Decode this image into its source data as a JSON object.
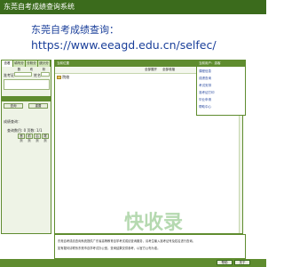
{
  "window": {
    "title": "东莞自考成绩查询系统"
  },
  "overlay": {
    "line1": "东莞自考成绩查询：",
    "line2": "https://www.eeagd.edu.cn/selfec/"
  },
  "left_panel": {
    "tabs": [
      "查看",
      "填写分数",
      "分析分布",
      "统计分析"
    ],
    "fields": [
      {
        "label": "准考证",
        "value": ""
      },
      {
        "label": "姓名",
        "value": ""
      }
    ],
    "buttons": [
      "查询",
      "重置"
    ],
    "result_label": "成绩查询：",
    "count_label": "查询数目: 0  页数: 1/1",
    "pager": [
      "首页",
      "前页",
      "后页",
      "尾页"
    ]
  },
  "main_panel": {
    "header": "当前位置",
    "toolbar": [
      "全部展开",
      "全部收缩"
    ],
    "tree_root": "院校"
  },
  "right_panel": {
    "header": "当前用户：游客",
    "items": [
      "课程信息",
      "成绩查询",
      "考试安排",
      "准考证打印",
      "毕业申请",
      "帮助中心"
    ]
  },
  "bottom_text": [
    "东莞自考成绩查询系统提供广东省高等教育自学考试成绩查询服务，请考生输入准考证号及姓名进行查询。",
    "如有疑问请联系东莞市自学考试办公室。查询结果仅供参考，以官方公布为准。"
  ],
  "status_buttons": [
    "帮助",
    "关于"
  ],
  "watermark": "快收录"
}
